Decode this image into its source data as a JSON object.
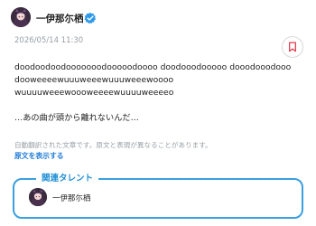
{
  "author": {
    "name": "一伊那尓栖",
    "avatar_icon": "avatar-portrait",
    "verified_icon": "verified-badge-icon"
  },
  "post": {
    "timestamp": "2026/05/14 11:30",
    "body_lines": [
      "doodoodoodooooooodooooodoooo doodooodooooo dooodooodooo",
      "dooweeeewuuuweeewuuuweeewoooo",
      "wuuuuweeewoooweeeewuuuuweeeeo",
      "",
      "…あの曲が頭から離れないんだ…"
    ],
    "translation_note": "自動翻訳された文章です。原文と表現が異なることがあります。",
    "show_original_label": "原文を表示する"
  },
  "actions": {
    "bookmark_icon": "bookmark-icon"
  },
  "related_talent": {
    "title": "関連タレント",
    "items": [
      {
        "name": "一伊那尓栖",
        "avatar_icon": "avatar-portrait"
      }
    ]
  },
  "colors": {
    "accent_blue": "#3aa0e0",
    "link_blue": "#1f7bd8",
    "bookmark_red": "#e0394b",
    "muted_text": "#9aa0a6",
    "verified_blue": "#2f9ae8"
  }
}
